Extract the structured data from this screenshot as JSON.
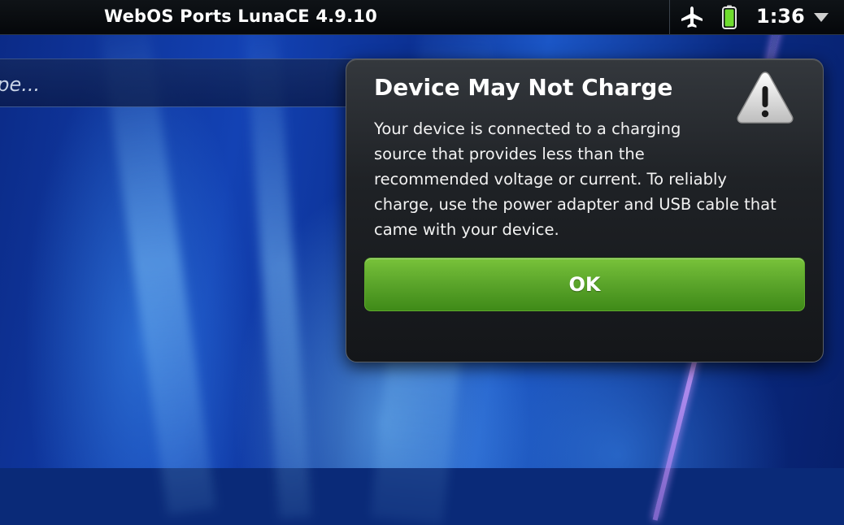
{
  "statusbar": {
    "title": "WebOS Ports LunaCE 4.9.10",
    "time": "1:36",
    "icons": [
      "airplane-icon",
      "battery-icon",
      "chevron-down-icon"
    ]
  },
  "search": {
    "placeholder_visible": "ype..."
  },
  "dialog": {
    "title": "Device May Not Charge",
    "body": "Your device is connected to a charging\nsource that provides less than the\nrecommended voltage or current. To reliably\ncharge, use the power adapter and USB cable that\ncame with your device.",
    "ok_label": "OK",
    "icon": "warning-icon"
  },
  "colors": {
    "ok_button": "#5aa42a",
    "battery": "#6fdc2e",
    "dialog_bg": "#1f2226",
    "wallpaper": "#1342b4"
  }
}
